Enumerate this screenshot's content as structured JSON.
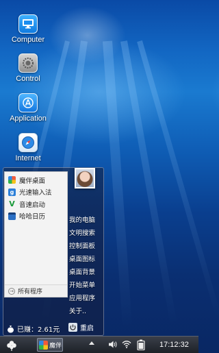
{
  "desktop": {
    "icons": [
      {
        "label": "Computer",
        "icon": "computer-icon"
      },
      {
        "label": "Control",
        "icon": "control-panel-icon"
      },
      {
        "label": "Application",
        "icon": "app-store-icon"
      },
      {
        "label": "Internet",
        "icon": "safari-icon"
      }
    ]
  },
  "start_menu": {
    "recent_programs": [
      {
        "label": "魔伴桌面",
        "icon": "mobannerdesk-icon"
      },
      {
        "label": "光速输入法",
        "icon": "input-method-icon"
      },
      {
        "label": "音速启动",
        "icon": "launcher-icon"
      },
      {
        "label": "哈哈日历",
        "icon": "calendar-icon"
      }
    ],
    "all_programs_label": "所有程序",
    "right_links": [
      "我的电脑",
      "文明搜索",
      "控制面板",
      "桌面图标",
      "桌面背景",
      "开始菜单",
      "应用程序",
      "关于.."
    ],
    "balance_label": "已赚：2.61元",
    "restart_label": "重启"
  },
  "taskbar": {
    "active_task_label": "魔伴",
    "clock": "17:12:32"
  },
  "colors": {
    "wallpaper_top": "#0a4aa6",
    "wallpaper_bottom": "#092763",
    "taskbar": "#1d2127"
  }
}
